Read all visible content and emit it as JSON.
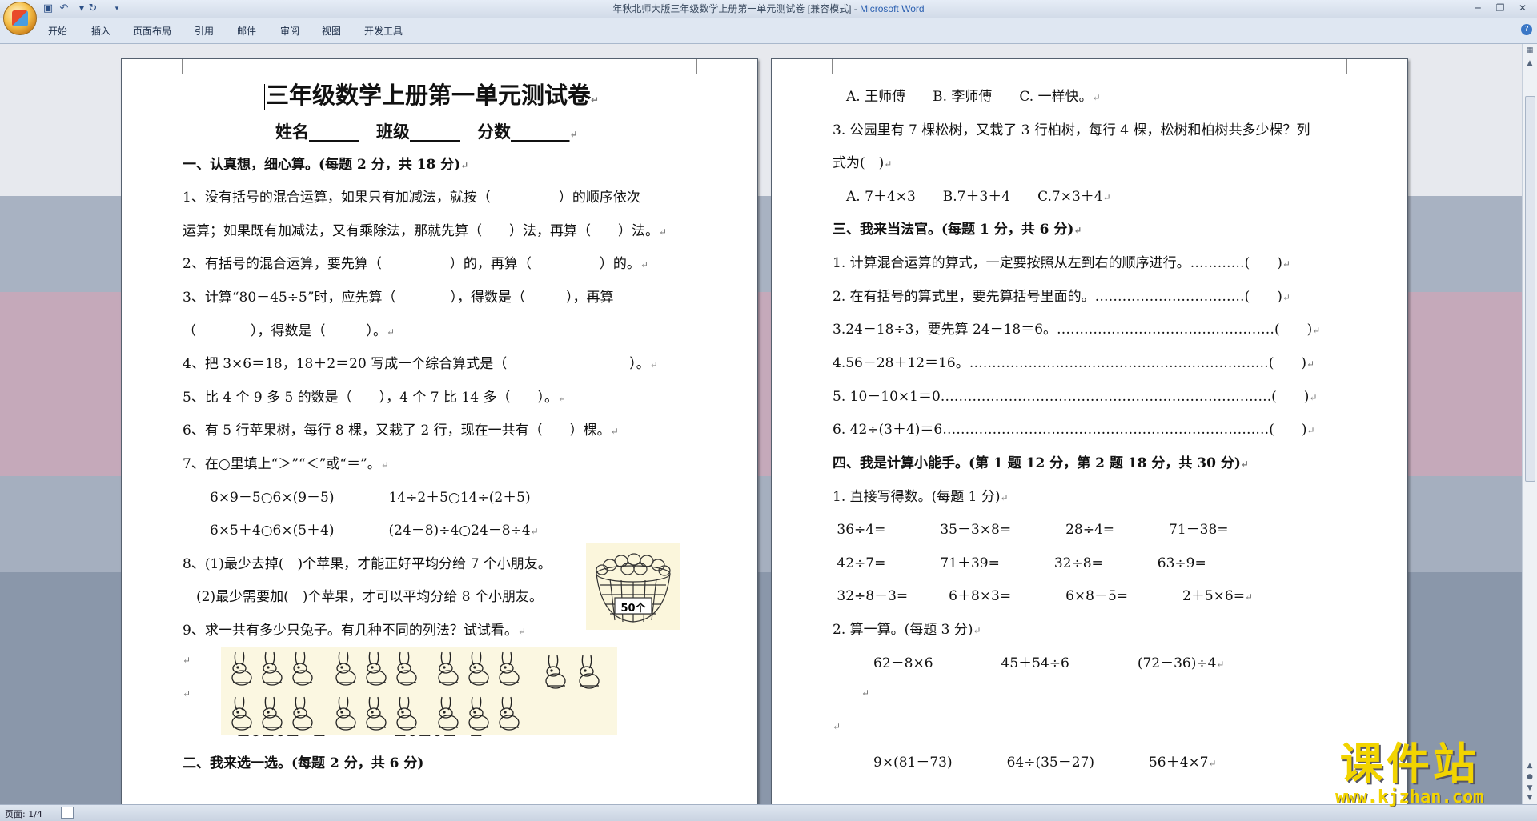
{
  "window": {
    "title": "年秋北师大版三年级数学上册第一单元测试卷 [兼容模式] - ",
    "app_name": "Microsoft Word"
  },
  "quick_access": [
    "save-icon",
    "undo-icon",
    "redo-icon",
    "customize-icon"
  ],
  "ribbon": {
    "tabs": [
      "开始",
      "插入",
      "页面布局",
      "引用",
      "邮件",
      "审阅",
      "视图",
      "开发工具"
    ]
  },
  "status": {
    "page": "页面: 1/4"
  },
  "left_page": {
    "title": "三年级数学上册第一单元测试卷",
    "subtitle": "姓名______　班级______　分数_______",
    "lines": [
      "一、认真想，细心算。(每题 2 分，共 18 分)",
      "1、没有括号的混合运算，如果只有加减法，就按（　　　　　）的顺序依次",
      "运算；如果既有加减法，又有乘除法，那就先算（　　）法，再算（　　）法。",
      "2、有括号的混合运算，要先算（　　　　　）的，再算（　　　　　）的。",
      "3、计算“80－45÷5”时，应先算（　　　　），得数是（　　　），再算",
      "（　　　　），得数是（　　　）。",
      "4、把 3×6＝18，18＋2＝20 写成一个综合算式是（　　　　　　　　　）。",
      "5、比 4 个 9 多 5 的数是（　　），4 个 7 比 14 多（　　）。",
      "6、有 5 行苹果树，每行 8 棵，又栽了 2 行，现在一共有（　　）棵。",
      "7、在○里填上“＞”“＜”或“＝”。",
      "　　6×9－5○6×(9－5)　　　　14÷2＋5○14÷(2＋5)",
      "　　6×5＋4○6×(5＋4)　　　　(24－8)÷4○24－8÷4",
      "8、(1)最少去掉(　)个苹果，才能正好平均分给 7 个小朋友。",
      "　(2)最少需要加(　)个苹果，才可以平均分给 8 个小朋友。",
      "9、求一共有多少只兔子。有几种不同的列法？试试看。",
      "",
      "",
      "　　　　□○□○□＝□　　　　　□○□○□＝□",
      "二、我来选一选。(每题 2 分，共 6 分)"
    ],
    "basket_label": "50个"
  },
  "right_page": {
    "lines": [
      "　A. 王师傅　　B. 李师傅　　C. 一样快。",
      "3. 公园里有 7 棵松树，又栽了 3 行柏树，每行 4 棵，松树和柏树共多少棵？列",
      "式为(　)",
      "　A. 7＋4×3　　B.7＋3＋4　　C.7×3＋4",
      "三、我来当法官。(每题 1 分，共 6 分)",
      "1. 计算混合运算的算式，一定要按照从左到右的顺序进行。…………(　　)",
      "2. 在有括号的算式里，要先算括号里面的。……………………………(　　)",
      "3.24－18÷3，要先算 24－18＝6。…………………………………………(　　)",
      "4.56－28＋12＝16。…………………………………………………………(　　)",
      "5. 10－10×1＝0……………………………………………………………….(　　)",
      "6. 42÷(3＋4)＝6………………………………………………………………(　　)",
      "四、我是计算小能手。(第 1 题 12 分，第 2 题 18 分，共 30 分)",
      "1. 直接写得数。(每题 1 分)",
      " 36÷4=　　　　35－3×8=　　　　28÷4=　　　　71－38=",
      " 42÷7=　　　　71＋39=　　　　32÷8=　　　　63÷9=",
      " 32÷8－3=　　　6＋8×3=　　　　6×8－5=　　　　2＋5×6=",
      "2. 算一算。(每题 3 分)",
      "　　　62－8×6　　　　　45＋54÷6　　　　　(72－36)÷4",
      "",
      "",
      "　　　9×(81－73)　　　　64÷(35－27)　　　　56＋4×7"
    ]
  },
  "watermark": {
    "text": "课件站",
    "url": "www.kjzhan.com"
  },
  "colors": {
    "workspace": "#8f9bad",
    "band_pink": "#b9a4b4",
    "title_app": "#2a5fb0",
    "watermark": "#f2d400"
  }
}
